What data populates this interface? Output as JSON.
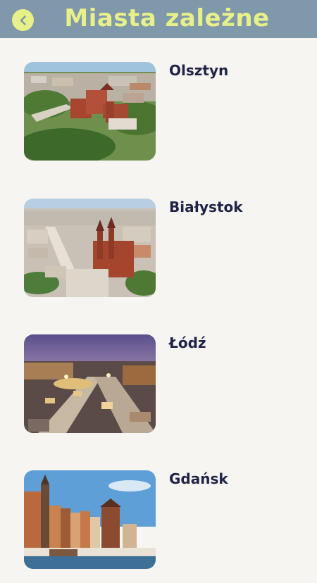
{
  "header": {
    "title": "Miasta zależne",
    "back_icon": "chevron-left-icon",
    "accent_color": "#e8f08a",
    "bar_color": "#7f98aa"
  },
  "cities": [
    {
      "name": "Olsztyn"
    },
    {
      "name": "Białystok"
    },
    {
      "name": "Łódź"
    },
    {
      "name": "Gdańsk"
    }
  ]
}
